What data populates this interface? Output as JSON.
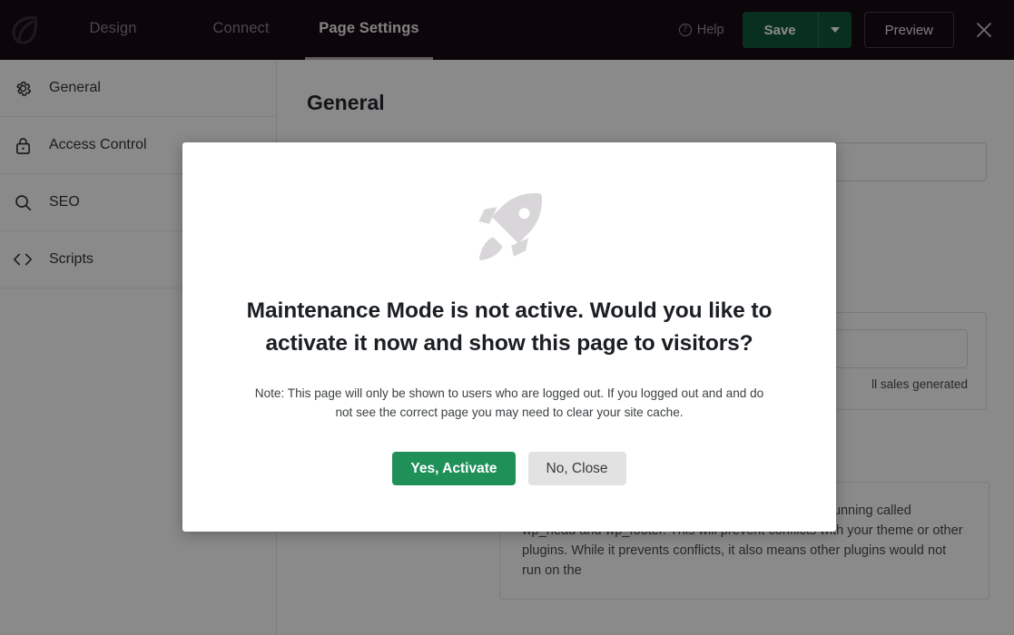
{
  "topbar": {
    "logo_name": "seedprod-leaf-logo",
    "tabs": [
      {
        "label": "Design",
        "active": false
      },
      {
        "label": "Connect",
        "active": false
      },
      {
        "label": "Page Settings",
        "active": true
      }
    ],
    "help_label": "Help",
    "help_glyph": "?",
    "save_label": "Save",
    "save_caret_name": "chevron-down-icon",
    "preview_label": "Preview",
    "close_label": "×",
    "bg_color": "#170a12",
    "save_color": "#11593a"
  },
  "sidebar": {
    "items": [
      {
        "label": "General",
        "icon": "gear-icon"
      },
      {
        "label": "Access Control",
        "icon": "lock-icon"
      },
      {
        "label": "SEO",
        "icon": "search-icon"
      },
      {
        "label": "Scripts",
        "icon": "code-brackets-icon"
      }
    ]
  },
  "content": {
    "title": "General",
    "card_note": "ll sales generated",
    "toggle_color": "#b32020",
    "isolation_text": "Isolation Mode prevents two WordPress hooks from running called wp_head and wp_footer. This will prevent conflicts with your theme or other plugins. While it prevents conflicts, it also means other plugins would not run on the"
  },
  "modal": {
    "icon_name": "rocket-icon",
    "heading": "Maintenance Mode is not active. Would you like to activate it now and show this page to visitors?",
    "note": "Note: This page will only be shown to users who are logged out. If you logged out and and do not see the correct page you may need to clear your site cache.",
    "confirm_label": "Yes, Activate",
    "dismiss_label": "No, Close",
    "confirm_color": "#1f9158",
    "dismiss_color": "#e2e2e2"
  }
}
